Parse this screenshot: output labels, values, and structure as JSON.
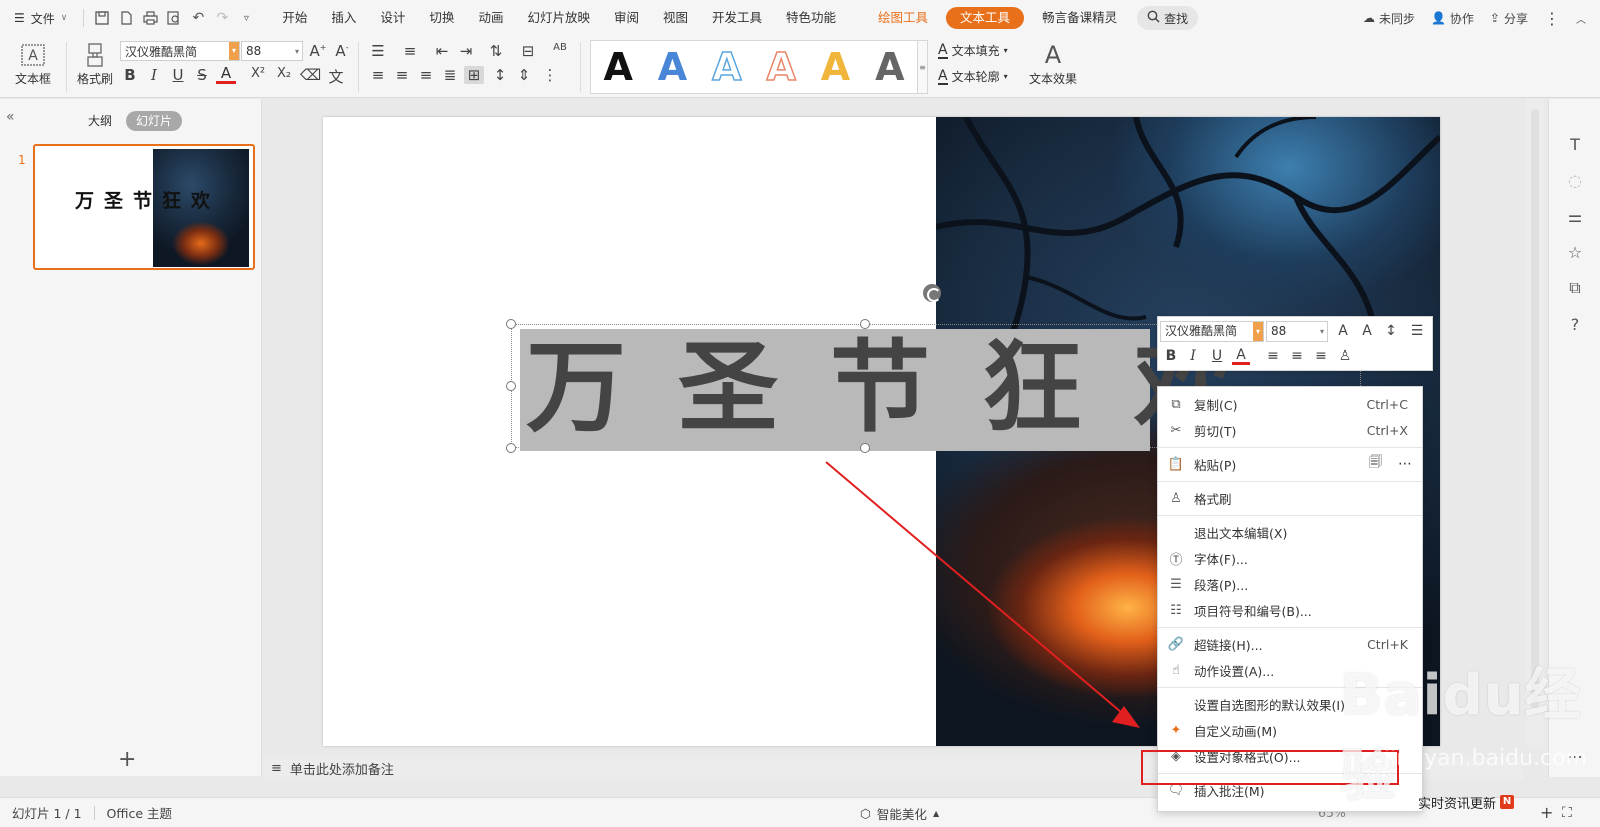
{
  "menubar": {
    "file_label": "文件",
    "tabs": [
      "开始",
      "插入",
      "设计",
      "切换",
      "动画",
      "幻灯片放映",
      "审阅",
      "视图",
      "开发工具",
      "特色功能"
    ],
    "tab_drawing_tools": "绘图工具",
    "tab_text_tools": "文本工具",
    "tab_extra": "畅言备课精灵",
    "search_label": "查找",
    "sync_label": "未同步",
    "collab_label": "协作",
    "share_label": "分享"
  },
  "ribbon": {
    "textbox_label": "文本框",
    "format_painter_label": "格式刷",
    "font_name": "汉仪雅酷黑简",
    "font_size": "88",
    "text_fill_label": "文本填充",
    "text_outline_label": "文本轮廓",
    "text_effect_label": "文本效果",
    "styles": [
      {
        "color": "#111111",
        "outline": false
      },
      {
        "color": "#4a86d8",
        "outline": false
      },
      {
        "color": "#5aa7e0",
        "outline": true
      },
      {
        "color": "#e8866a",
        "outline": true
      },
      {
        "color": "#f0b63c",
        "outline": false
      },
      {
        "color": "#666666",
        "outline": false
      }
    ],
    "style_glyph": "A"
  },
  "leftpane": {
    "tab_outline": "大纲",
    "tab_slides": "幻灯片",
    "slide_number": "1",
    "thumb_title": "万圣节狂欢"
  },
  "slide": {
    "title": "万圣节狂欢"
  },
  "notes": {
    "placeholder": "单击此处添加备注"
  },
  "minitoolbar": {
    "font_name": "汉仪雅酷黑简",
    "font_size": "88"
  },
  "contextmenu": {
    "items": [
      {
        "label": "复制(C)",
        "shortcut": "Ctrl+C"
      },
      {
        "label": "剪切(T)",
        "shortcut": "Ctrl+X"
      },
      {
        "label": "粘贴(P)",
        "shortcut": ""
      },
      {
        "label": "格式刷",
        "shortcut": ""
      },
      {
        "label": "退出文本编辑(X)",
        "shortcut": ""
      },
      {
        "label": "字体(F)...",
        "shortcut": ""
      },
      {
        "label": "段落(P)...",
        "shortcut": ""
      },
      {
        "label": "项目符号和编号(B)...",
        "shortcut": ""
      },
      {
        "label": "超链接(H)...",
        "shortcut": "Ctrl+K"
      },
      {
        "label": "动作设置(A)...",
        "shortcut": ""
      },
      {
        "label": "设置自选图形的默认效果(I)",
        "shortcut": ""
      },
      {
        "label": "自定义动画(M)",
        "shortcut": ""
      },
      {
        "label": "设置对象格式(O)...",
        "shortcut": ""
      },
      {
        "label": "插入批注(M)",
        "shortcut": ""
      }
    ],
    "highlight_color": "#e02020"
  },
  "statusbar": {
    "slide_count": "幻灯片 1 / 1",
    "theme": "Office 主题",
    "beautify": "智能美化",
    "zoom": "65%"
  },
  "watermark": {
    "logo": "Baidu经验",
    "url": "jingyan.baidu.com"
  },
  "toast": {
    "label": "实时资讯更新",
    "badge": "N"
  },
  "colors": {
    "accent": "#e8701a",
    "annotation_red": "#e02020"
  }
}
